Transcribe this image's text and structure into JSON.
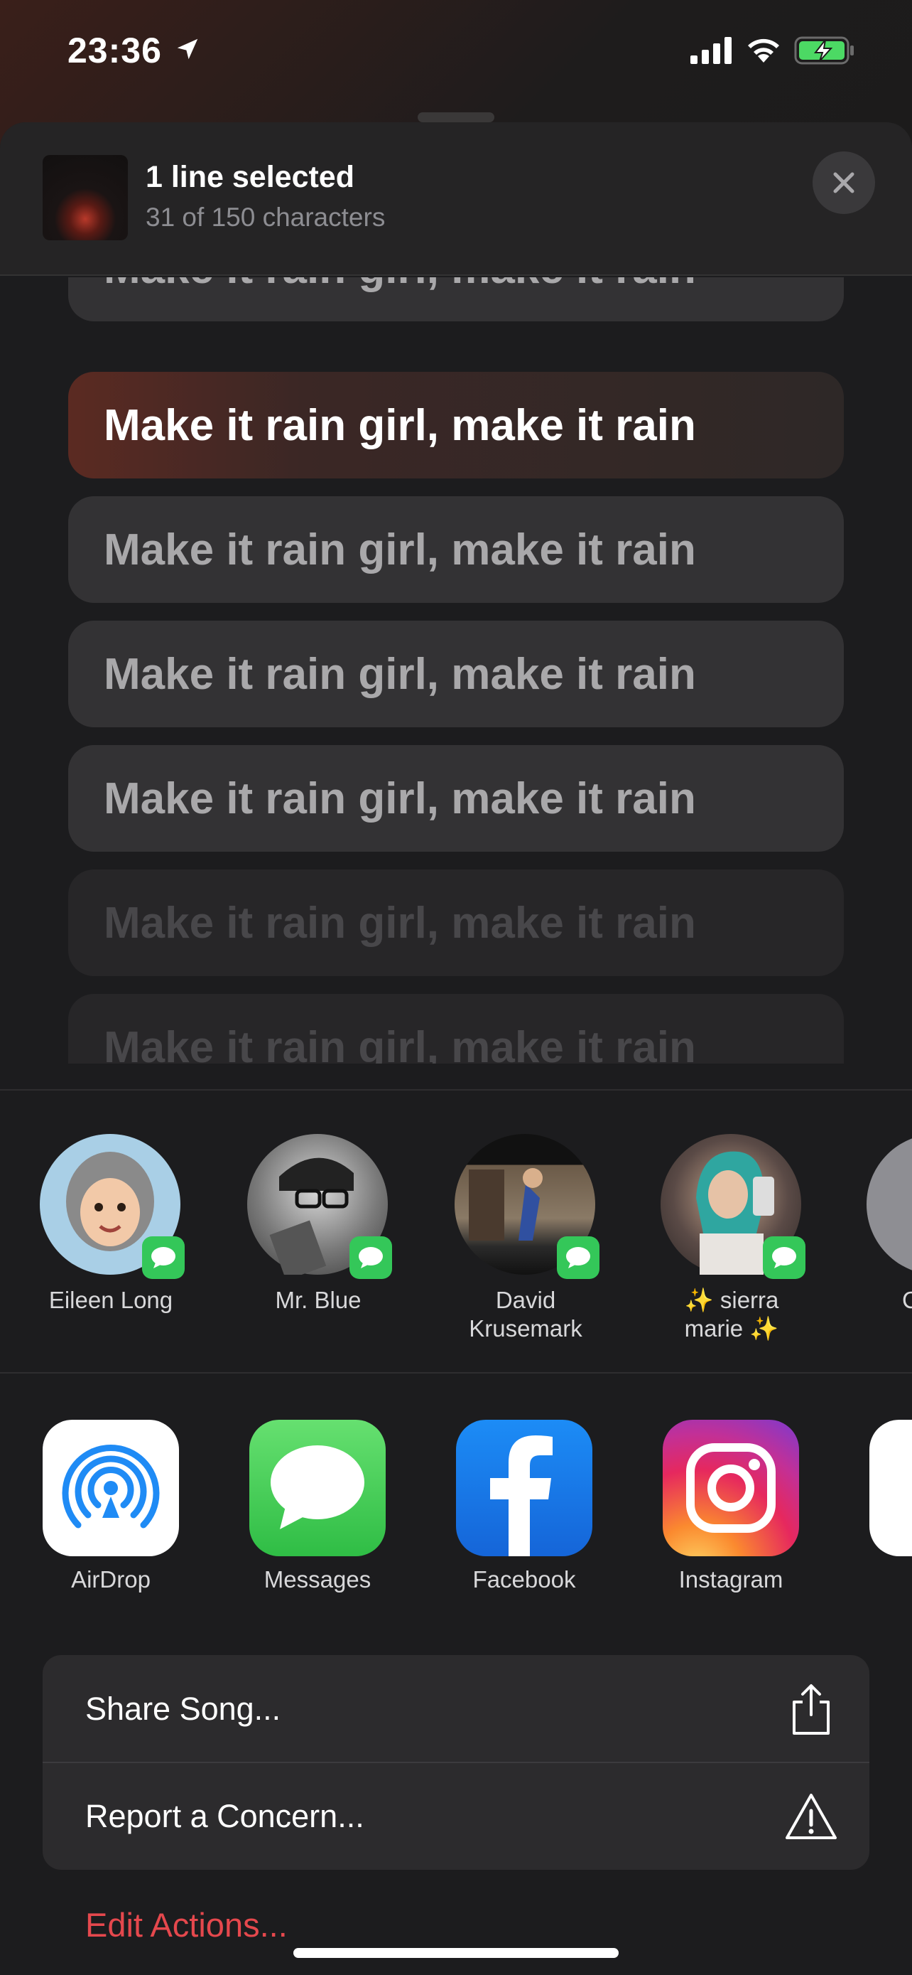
{
  "status_bar": {
    "time": "23:36"
  },
  "header": {
    "title": "1 line selected",
    "subtitle": "31 of 150 characters"
  },
  "lyrics": [
    "Make it rain girl, make it rain",
    "Make it rain girl, make it rain",
    "Make it rain girl, make it rain",
    "Make it rain girl, make it rain",
    "Make it rain girl, make it rain",
    "Make it rain girl, make it rain",
    "Make it rain girl, make it rain"
  ],
  "people": [
    {
      "name": "Eileen Long"
    },
    {
      "name": "Mr. Blue"
    },
    {
      "name": "David Krusemark"
    },
    {
      "name": "✨ sierra marie ✨"
    },
    {
      "name": "C"
    }
  ],
  "apps": [
    {
      "label": "AirDrop",
      "icon": "airdrop-icon"
    },
    {
      "label": "Messages",
      "icon": "messages-icon"
    },
    {
      "label": "Facebook",
      "icon": "facebook-icon"
    },
    {
      "label": "Instagram",
      "icon": "instagram-icon"
    },
    {
      "label": "",
      "icon": "more-app-icon"
    }
  ],
  "actions": [
    {
      "label": "Share Song...",
      "icon": "share-icon"
    },
    {
      "label": "Report a Concern...",
      "icon": "warning-icon"
    }
  ],
  "edit_actions": "Edit Actions...",
  "colors": {
    "accent_red": "#e5484d",
    "messages_green": "#34c759",
    "facebook_blue": "#1877f2"
  }
}
